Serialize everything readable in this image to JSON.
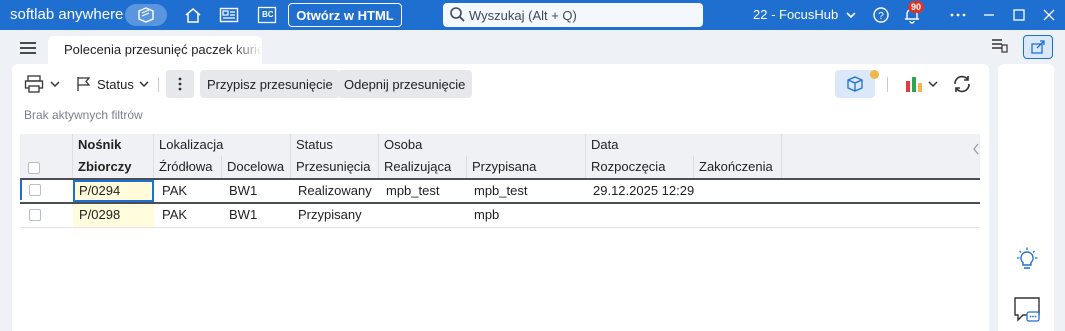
{
  "titlebar": {
    "brand": "softlab anywhere",
    "open_html_label": "Otwórz w HTML",
    "search_placeholder": "Wyszukaj (Alt + Q)",
    "tenant": "22 - FocusHub",
    "notifications_count": "90",
    "bc_label": "BC"
  },
  "tab": {
    "label": "Polecenia przesunięć paczek kurierskich"
  },
  "toolbar": {
    "status_label": "Status",
    "assign_label": "Przypisz przesunięcie",
    "unassign_label": "Odepnij przesunięcie"
  },
  "filters_text": "Brak aktywnych filtrów",
  "grid": {
    "group_headers": {
      "nosnik": "Nośnik",
      "lokalizacja": "Lokalizacja",
      "status": "Status",
      "osoba": "Osoba",
      "data": "Data"
    },
    "columns": {
      "zbiorczy": "Zbiorczy",
      "zrodlowa": "Źródłowa",
      "docelowa": "Docelowa",
      "przesuniecia": "Przesunięcia",
      "realizujaca": "Realizująca",
      "przypisana": "Przypisana",
      "rozpoczecia": "Rozpoczęcia",
      "zakonczenia": "Zakończenia"
    },
    "rows": [
      {
        "zbiorczy": "P/0294",
        "zrodlowa": "PAK",
        "docelowa": "BW1",
        "status": "Realizowany",
        "realizujaca": "mpb_test",
        "przypisana": "mpb_test",
        "rozpoczecia": "29.12.2025 12:29",
        "zakonczenia": ""
      },
      {
        "zbiorczy": "P/0298",
        "zrodlowa": "PAK",
        "docelowa": "BW1",
        "status": "Przypisany",
        "realizujaca": "",
        "przypisana": "mpb",
        "rozpoczecia": "",
        "zakonczenia": ""
      }
    ]
  },
  "colors": {
    "titlebar": "#1f6fd1",
    "selection_border": "#1f6fd1",
    "badge": "#d9352a",
    "yellow_cell": "#fffbdb"
  }
}
